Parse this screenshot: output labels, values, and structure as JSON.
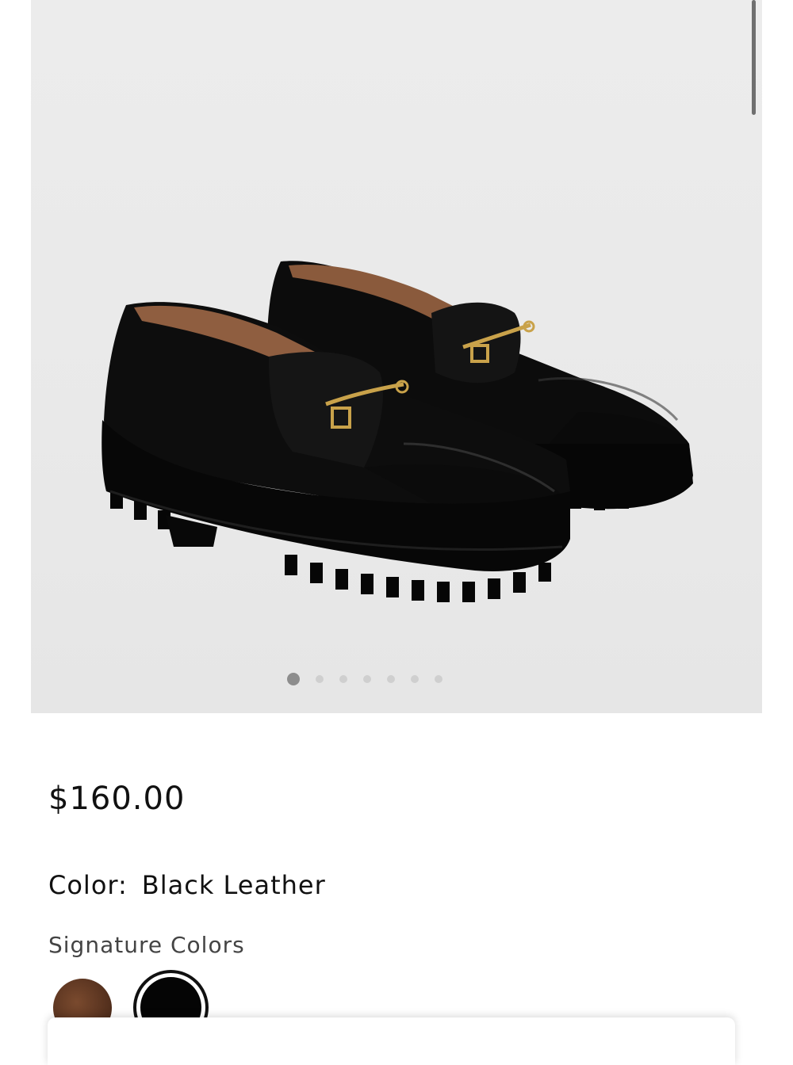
{
  "product": {
    "price": "$160.00",
    "color_label": "Color:",
    "color_value": "Black Leather",
    "swatch_group_label": "Signature Colors",
    "swatches": [
      {
        "name": "brown-leather",
        "color": "#5a3420",
        "selected": false
      },
      {
        "name": "black-leather",
        "color": "#050505",
        "selected": true
      }
    ]
  },
  "gallery": {
    "image_count": 7,
    "active_index": 0
  },
  "colors": {
    "hero_background": "#eaeaea",
    "shoe_leather": "#0b0b0b",
    "shoe_lining": "#9a6a48",
    "hardware": "#c9a24a"
  }
}
